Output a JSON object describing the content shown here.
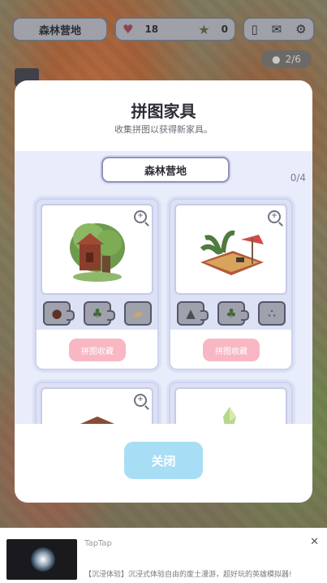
{
  "hud": {
    "location": "森林营地",
    "hearts": "18",
    "stars": "0",
    "icons": [
      "phone-icon",
      "mail-icon",
      "gear-icon"
    ]
  },
  "progress": {
    "text": "2/6"
  },
  "modal": {
    "title": "拼图家具",
    "subtitle": "收集拼图以获得新家具。",
    "category": "森林营地",
    "count": "0/4",
    "cards": [
      {
        "name": "treehouse",
        "pieces": [
          "acorn-piece",
          "bush-piece",
          "plank-piece"
        ],
        "button": "拼图收藏"
      },
      {
        "name": "camp-table",
        "pieces": [
          "stone-piece",
          "bush-piece",
          "pebbles-piece"
        ],
        "button": "拼图收藏"
      },
      {
        "name": "cabin",
        "pieces": [],
        "button": ""
      },
      {
        "name": "green-crystal",
        "pieces": [],
        "button": ""
      }
    ],
    "close_label": "关闭"
  },
  "ad": {
    "brand": "TapTap",
    "description": "【沉浸体验】沉浸式体验自由的废土漫游，超好玩的英雄模拟器!"
  },
  "colors": {
    "accent_pink": "#f8b7c3",
    "close_blue": "#a8def5",
    "panel_lavender": "#e9ecfa"
  }
}
